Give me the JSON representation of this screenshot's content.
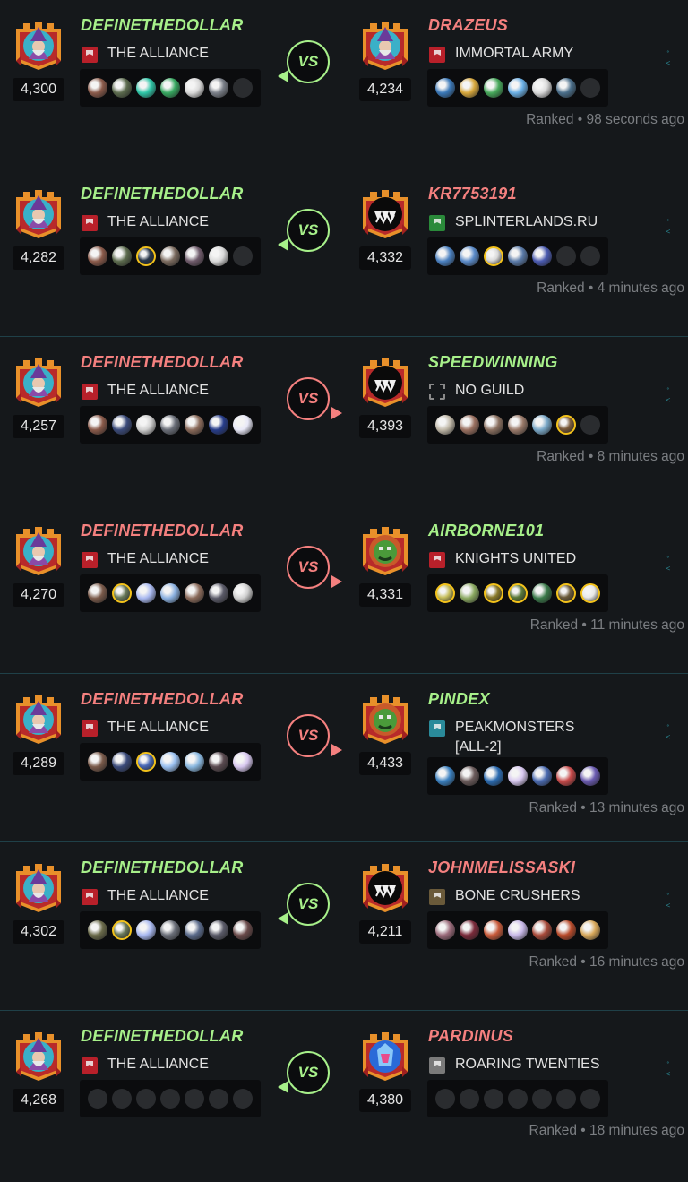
{
  "battles": [
    {
      "time": "Ranked • 98 seconds ago",
      "winner": "left",
      "left": {
        "name": "DEFINETHEDOLLAR",
        "guild": "THE ALLIANCE",
        "rating": "4,300",
        "avatar": "wizard",
        "cards": [
          "#8a5a4a|n",
          "#5b6a4d|n",
          "#2ec7a8|n",
          "#36a860|n",
          "#d9d9d9|n",
          "#7a7f88|n",
          "empty|n"
        ]
      },
      "right": {
        "name": "DRAZEUS",
        "guild": "IMMORTAL ARMY",
        "rating": "4,234",
        "avatar": "wizard",
        "cards": [
          "#3a78b8|n",
          "#d8a83c|n",
          "#46a85a|n",
          "#6bb0e6|n",
          "#d9d9d9|n",
          "#4a6e8a|n",
          "empty|n"
        ]
      }
    },
    {
      "time": "Ranked • 4 minutes ago",
      "winner": "left",
      "left": {
        "name": "DEFINETHEDOLLAR",
        "guild": "THE ALLIANCE",
        "rating": "4,282",
        "avatar": "wizard",
        "cards": [
          "#8a5a4a|n",
          "#5b6a4d|n",
          "#263548|g",
          "#7a6a5e|n",
          "#6e5a6a|n",
          "#d9d9d9|n",
          "empty|n"
        ]
      },
      "right": {
        "name": "KR7753191",
        "guild": "SPLINTERLANDS.RU",
        "rating": "4,332",
        "avatar": "monster",
        "cards": [
          "#4a80c0|n",
          "#5a8ac8|n",
          "#d9d9d9|g",
          "#5a7aa8|n",
          "#4a5ab0|n",
          "empty|n",
          "empty|n"
        ]
      }
    },
    {
      "time": "Ranked • 8 minutes ago",
      "winner": "right",
      "left": {
        "name": "DEFINETHEDOLLAR",
        "guild": "THE ALLIANCE",
        "rating": "4,257",
        "avatar": "wizard",
        "cards": [
          "#8a5a4a|n",
          "#3a4a7a|n",
          "#d0d0d0|n",
          "#6a6e78|n",
          "#8a6a5a|n",
          "#263c8a|n",
          "#e8e8f8|n"
        ]
      },
      "right": {
        "name": "SPEEDWINNING",
        "guild": "NO GUILD",
        "rating": "4,393",
        "avatar": "monster",
        "cards": [
          "#c0b8a8|n",
          "#9a7060|n",
          "#8a7060|n",
          "#9a7a6a|n",
          "#7aa8c8|n",
          "#7a5a3a|g",
          "empty|n"
        ]
      }
    },
    {
      "time": "Ranked • 11 minutes ago",
      "winner": "right",
      "left": {
        "name": "DEFINETHEDOLLAR",
        "guild": "THE ALLIANCE",
        "rating": "4,270",
        "avatar": "wizard",
        "cards": [
          "#7a5a4a|n",
          "#6a7a5a|g",
          "#a8b8f0|n",
          "#8ab0e0|n",
          "#8a6a5a|n",
          "#5a5a68|n",
          "#d0d0d0|n"
        ]
      },
      "right": {
        "name": "AIRBORNE101",
        "guild": "KNIGHTS UNITED",
        "rating": "4,331",
        "avatar": "orc",
        "cards": [
          "#c8c060|g",
          "#8aa860|n",
          "#8a7a2a|g",
          "#5a7a3a|g",
          "#3a7a4a|n",
          "#6a5a3a|g",
          "#e8e8e8|g"
        ]
      }
    },
    {
      "time": "Ranked • 13 minutes ago",
      "winner": "right",
      "left": {
        "name": "DEFINETHEDOLLAR",
        "guild": "THE ALLIANCE",
        "rating": "4,289",
        "avatar": "wizard",
        "cards": [
          "#7a5a4a|n",
          "#3a4a7a|n",
          "#4a6ab8|g",
          "#9ac0f0|n",
          "#8ab8e0|n",
          "#5a4a50|n",
          "#d8c8f0|n"
        ]
      },
      "right": {
        "name": "PINDEX",
        "guild": "PEAKMONSTERS [ALL-2]",
        "rating": "4,433",
        "avatar": "orc",
        "cards": [
          "#3a80c0|n",
          "#6a5a5a|n",
          "#2a6ab0|n",
          "#d8c8f0|n",
          "#4a6ab0|n",
          "#c84a4a|n",
          "#6a5ab0|n"
        ]
      }
    },
    {
      "time": "Ranked • 16 minutes ago",
      "winner": "left",
      "left": {
        "name": "DEFINETHEDOLLAR",
        "guild": "THE ALLIANCE",
        "rating": "4,302",
        "avatar": "wizard",
        "cards": [
          "#6a6a4a|n",
          "#6a7a5a|g",
          "#a8b8f0|n",
          "#6a6e78|n",
          "#5a6a8a|n",
          "#5a5a68|n",
          "#6a4a4a|n"
        ]
      },
      "right": {
        "name": "JOHNMELISSASKI",
        "guild": "BONE CRUSHERS",
        "rating": "4,211",
        "avatar": "monster",
        "cards": [
          "#9a6a7a|n",
          "#7a2a3a|n",
          "#c85a3a|n",
          "#c8b8e8|n",
          "#a84a3a|n",
          "#b84a2a|n",
          "#d8a85a|n"
        ]
      }
    },
    {
      "time": "Ranked • 18 minutes ago",
      "winner": "left",
      "left": {
        "name": "DEFINETHEDOLLAR",
        "guild": "THE ALLIANCE",
        "rating": "4,268",
        "avatar": "wizard",
        "cards": [
          "empty|n",
          "empty|n",
          "empty|n",
          "empty|n",
          "empty|n",
          "empty|n",
          "empty|n"
        ]
      },
      "right": {
        "name": "PARDINUS",
        "guild": "ROARING TWENTIES",
        "rating": "4,380",
        "avatar": "crystal",
        "cards": [
          "empty|n",
          "empty|n",
          "empty|n",
          "empty|n",
          "empty|n",
          "empty|n",
          "empty|n"
        ]
      }
    }
  ],
  "vs_label": "VS",
  "colors": {
    "win": "#a7f08a",
    "loss": "#f4807f",
    "gold": "#f3c21b",
    "background": "#15181b",
    "panel": "#0b0c0e"
  },
  "icons": {
    "guild-banner": "flag-icon",
    "no-guild": "dashed-square-icon",
    "avatar-frame": "castle-crest-icon"
  }
}
